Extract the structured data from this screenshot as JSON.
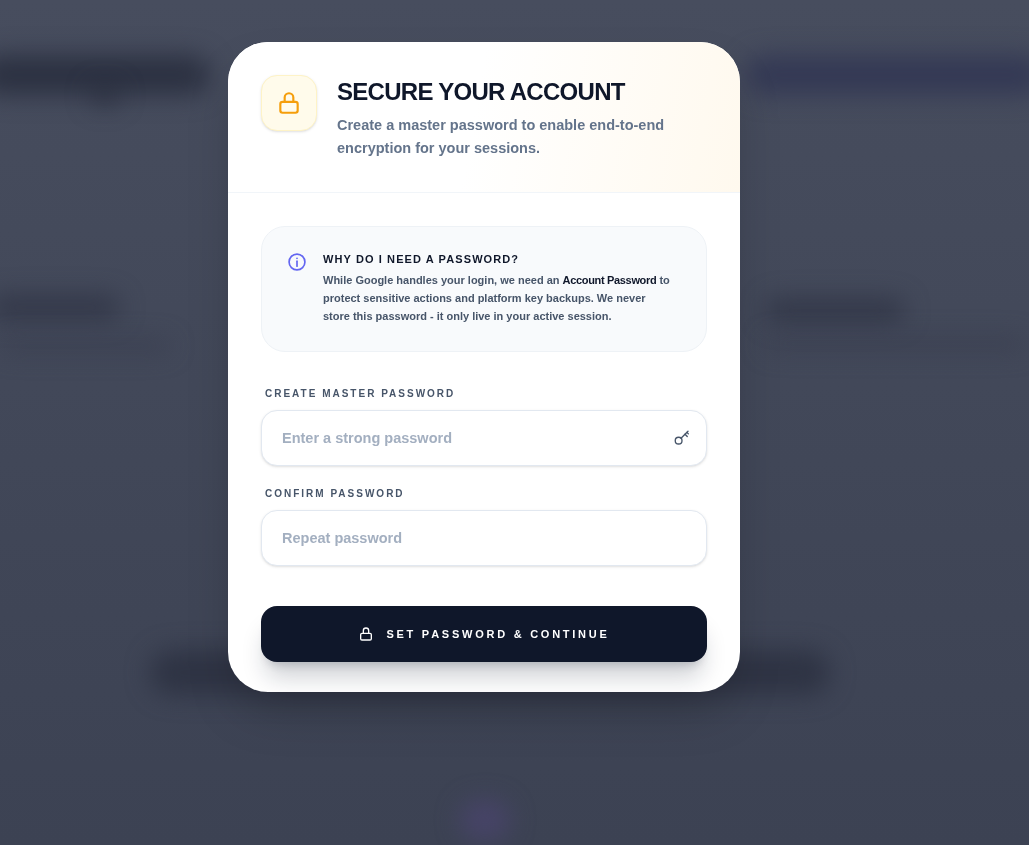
{
  "dialog": {
    "title": "SECURE YOUR ACCOUNT",
    "subtitle": "Create a master password to enable end-to-end encryption for your sessions.",
    "info": {
      "heading": "WHY DO I NEED A PASSWORD?",
      "text": "While Google handles your login, we need an **Account Password** to protect sensitive actions and platform key backups. We never store this password - it only live in your active session."
    },
    "fields": [
      {
        "label": "CREATE MASTER PASSWORD",
        "placeholder": "Enter a strong password",
        "kind": "key"
      },
      {
        "label": "CONFIRM PASSWORD",
        "placeholder": "Repeat password",
        "kind": "plain"
      }
    ],
    "submit": {
      "label": "SET PASSWORD & CONTINUE"
    }
  }
}
